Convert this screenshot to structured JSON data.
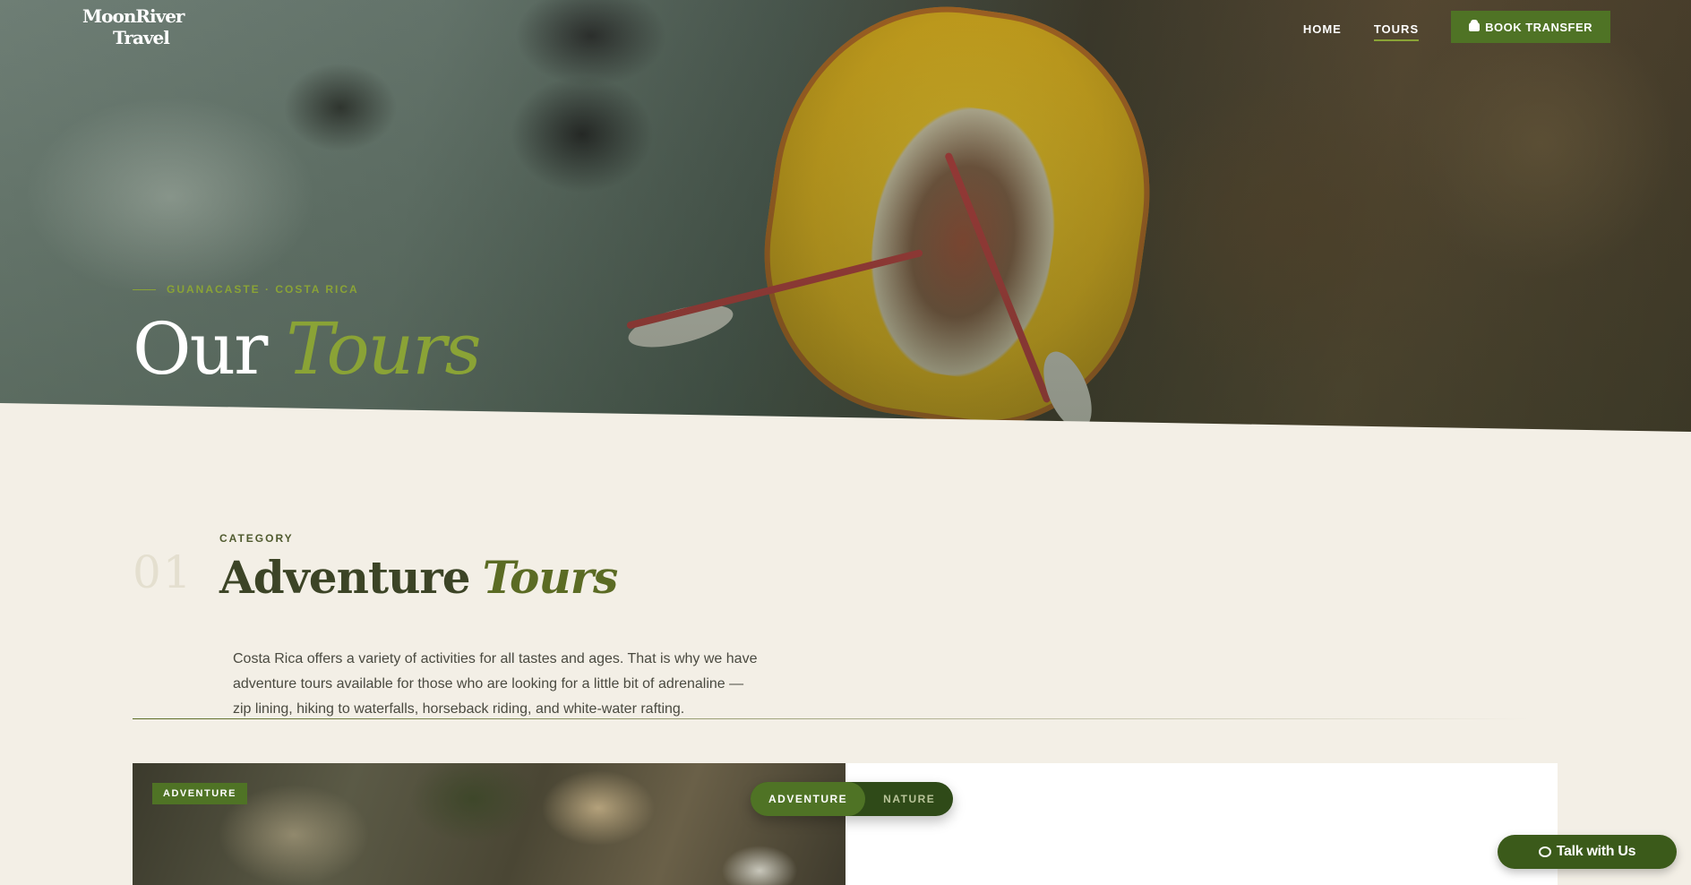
{
  "brand": {
    "logo_line1": "MoonRiver",
    "logo_line2": "Travel"
  },
  "nav": {
    "links": [
      {
        "label": "HOME"
      },
      {
        "label": "TOURS",
        "active": true
      }
    ],
    "cta_label": "BOOK TRANSFER",
    "cta_icon": "car-icon"
  },
  "hero": {
    "eyebrow": "GUANACASTE · COSTA RICA",
    "title_plain": "Our",
    "title_accent": "Tours"
  },
  "category": {
    "number": "01",
    "label": "CATEGORY",
    "title_plain": "Adventure",
    "title_accent": "Tours",
    "description": "Costa Rica offers a variety of activities for all tastes and ages. That is why we have adventure tours available for those who are looking for a little bit of adrenaline — zip lining, hiking to waterfalls, horseback riding, and white-water rafting."
  },
  "card": {
    "badge": "ADVENTURE",
    "toggle": [
      {
        "label": "ADVENTURE",
        "active": true
      },
      {
        "label": "NATURE",
        "active": false
      }
    ]
  },
  "chat": {
    "label": "Talk with Us",
    "icon": "chat-bubble-icon"
  },
  "colors": {
    "accent": "#8aa336",
    "primary": "#4f7325",
    "dark": "#3b5a1a",
    "background": "#f3efe6"
  }
}
